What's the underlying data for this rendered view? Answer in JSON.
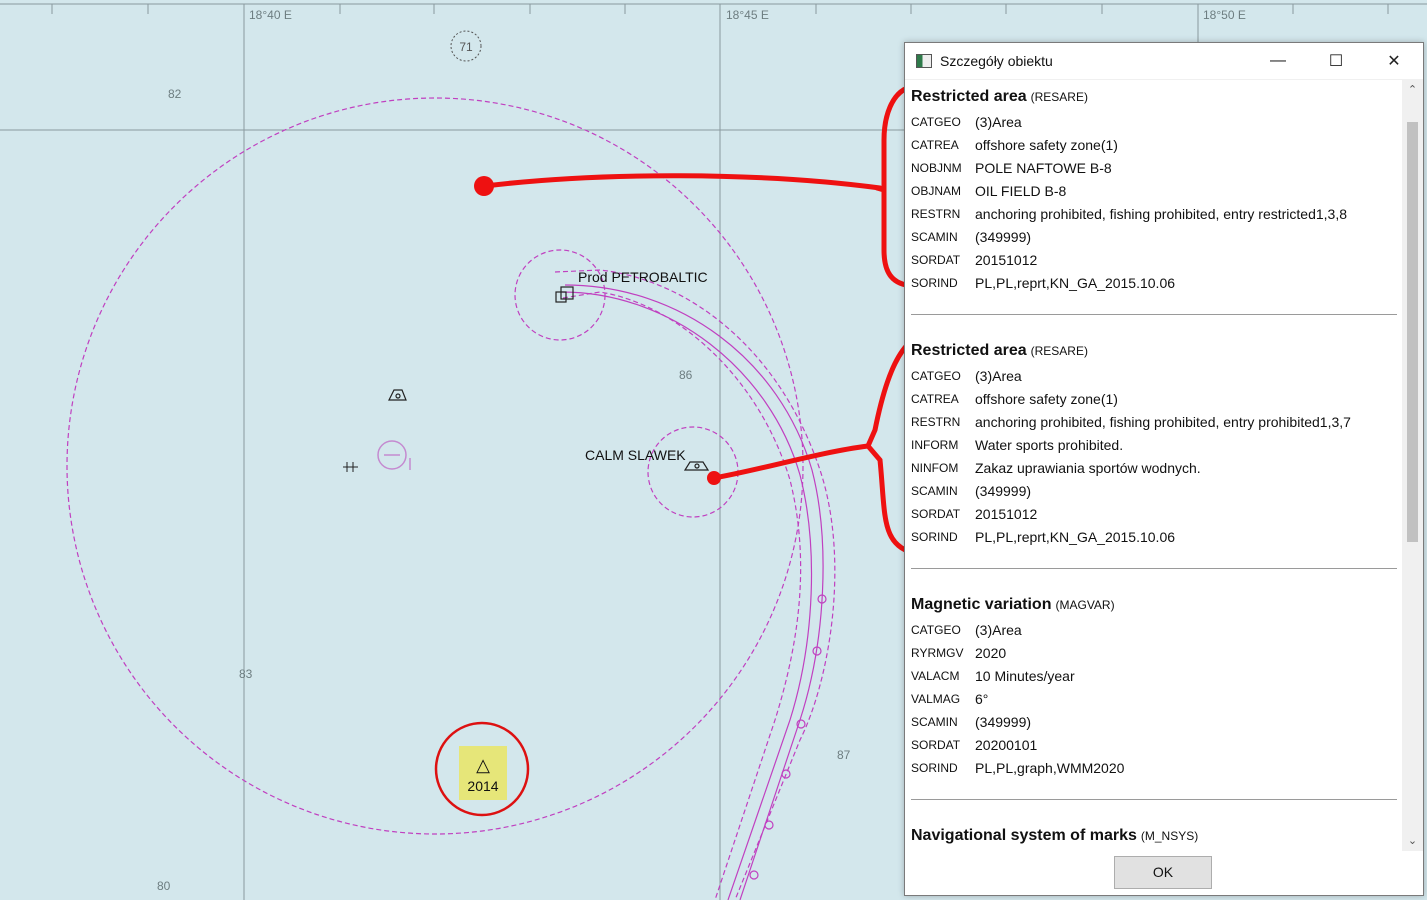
{
  "map": {
    "longitude_labels": [
      "18°40 E",
      "18°45 E",
      "18°50 E"
    ],
    "depths": [
      "82",
      "86",
      "83",
      "87",
      "80"
    ],
    "light_number": "71",
    "features": {
      "platform_label": "Prod PETROBALTIC",
      "buoy_label": "CALM SLAWEK",
      "year_badge": "2014"
    },
    "colors": {
      "sea": "#d3e7ec",
      "restricted_line": "#c040c0",
      "annotation": "#e11"
    }
  },
  "dialog": {
    "title": "Szczegóły obiektu",
    "sections": [
      {
        "name": "Restricted area",
        "code": "(RESARE)",
        "attributes": [
          {
            "key": "CATGEO",
            "value": "(3)Area"
          },
          {
            "key": "CATREA",
            "value": "offshore safety zone(1)"
          },
          {
            "key": "NOBJNM",
            "value": "POLE NAFTOWE B-8"
          },
          {
            "key": "OBJNAM",
            "value": "OIL FIELD B-8"
          },
          {
            "key": "RESTRN",
            "value": "anchoring prohibited, fishing prohibited, entry restricted1,3,8"
          },
          {
            "key": "SCAMIN",
            "value": "(349999)"
          },
          {
            "key": "SORDAT",
            "value": "20151012"
          },
          {
            "key": "SORIND",
            "value": "PL,PL,reprt,KN_GA_2015.10.06"
          }
        ]
      },
      {
        "name": "Restricted area",
        "code": "(RESARE)",
        "attributes": [
          {
            "key": "CATGEO",
            "value": "(3)Area"
          },
          {
            "key": "CATREA",
            "value": "offshore safety zone(1)"
          },
          {
            "key": "RESTRN",
            "value": "anchoring prohibited, fishing prohibited, entry prohibited1,3,7"
          },
          {
            "key": "INFORM",
            "value": "Water sports prohibited."
          },
          {
            "key": "NINFOM",
            "value": "Zakaz uprawiania sportów wodnych."
          },
          {
            "key": "SCAMIN",
            "value": "(349999)"
          },
          {
            "key": "SORDAT",
            "value": "20151012"
          },
          {
            "key": "SORIND",
            "value": "PL,PL,reprt,KN_GA_2015.10.06"
          }
        ]
      },
      {
        "name": "Magnetic variation",
        "code": "(MAGVAR)",
        "attributes": [
          {
            "key": "CATGEO",
            "value": "(3)Area"
          },
          {
            "key": "RYRMGV",
            "value": "2020"
          },
          {
            "key": "VALACM",
            "value": "10 Minutes/year"
          },
          {
            "key": "VALMAG",
            "value": "6°"
          },
          {
            "key": "SCAMIN",
            "value": "(349999)"
          },
          {
            "key": "SORDAT",
            "value": "20200101"
          },
          {
            "key": "SORIND",
            "value": "PL,PL,graph,WMM2020"
          }
        ]
      },
      {
        "name": "Navigational system of marks",
        "code": "(M_NSYS)",
        "attributes": []
      }
    ],
    "ok_label": "OK"
  }
}
